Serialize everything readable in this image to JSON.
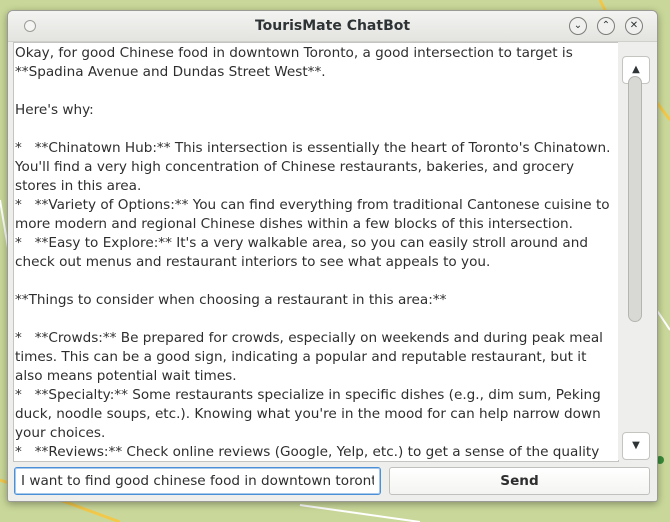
{
  "window": {
    "title": "TourisMate ChatBot"
  },
  "titlebar_buttons": {
    "minimize": "⌄",
    "maximize": "⌃",
    "close": "✕"
  },
  "chat": {
    "text": "Okay, for good Chinese food in downtown Toronto, a good intersection to target is **Spadina Avenue and Dundas Street West**.\n\nHere's why:\n\n*   **Chinatown Hub:** This intersection is essentially the heart of Toronto's Chinatown. You'll find a very high concentration of Chinese restaurants, bakeries, and grocery stores in this area.\n*   **Variety of Options:** You can find everything from traditional Cantonese cuisine to more modern and regional Chinese dishes within a few blocks of this intersection.\n*   **Easy to Explore:** It's a very walkable area, so you can easily stroll around and check out menus and restaurant interiors to see what appeals to you.\n\n**Things to consider when choosing a restaurant in this area:**\n\n*   **Crowds:** Be prepared for crowds, especially on weekends and during peak meal times. This can be a good sign, indicating a popular and reputable restaurant, but it also means potential wait times.\n*   **Specialty:** Some restaurants specialize in specific dishes (e.g., dim sum, Peking duck, noodle soups, etc.). Knowing what you're in the mood for can help narrow down your choices.\n*   **Reviews:** Check online reviews (Google, Yelp, etc.) to get a sense of the quality and service of different restaurants."
  },
  "scrollbar": {
    "up": "▲",
    "down": "▼"
  },
  "input": {
    "value": "I want to find good chinese food in downtown toronto, ca"
  },
  "send": {
    "label": "Send"
  },
  "colors": {
    "map_green": "#c9d89a",
    "map_road": "#f2c84b",
    "accent": "#4a90d9"
  }
}
